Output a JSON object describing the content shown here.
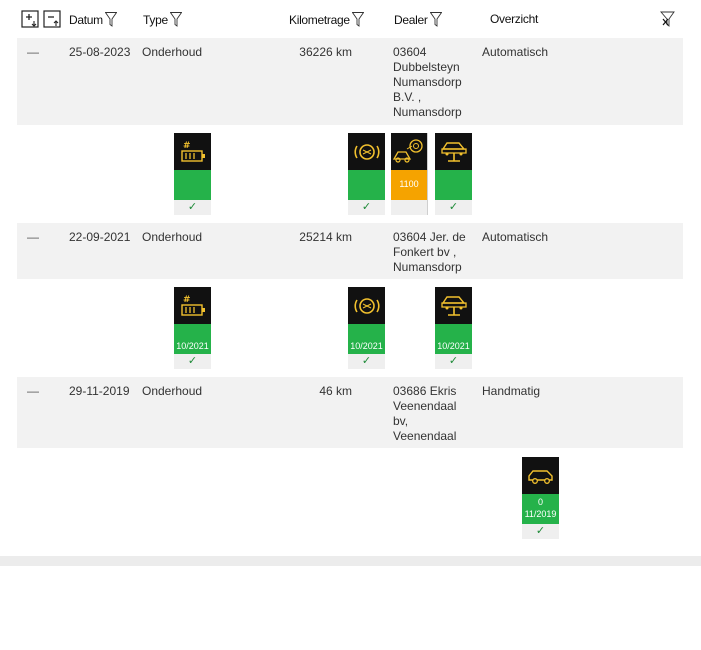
{
  "header": {
    "datum": "Datum",
    "type": "Type",
    "kilometrage": "Kilometrage",
    "dealer": "Dealer",
    "overzicht": "Overzicht"
  },
  "records": [
    {
      "dash": "—",
      "date": "25-08-2023",
      "type": "Onderhoud",
      "km": "36226 km",
      "dealer": [
        "03604",
        "Dubbelsteyn",
        "Numansdorp",
        "B.V. ,",
        "Numansdorp"
      ],
      "overzicht": "Automatisch"
    },
    {
      "dash": "—",
      "date": "22-09-2021",
      "type": "Onderhoud",
      "km": "25214 km",
      "dealer": [
        "03604 Jer. de",
        "Fonkert bv ,",
        "Numansdorp"
      ],
      "overzicht": "Automatisch"
    },
    {
      "dash": "—",
      "date": "29-11-2019",
      "type": "Onderhoud",
      "km": "46 km",
      "dealer": [
        "03686 Ekris",
        "Veenendaal",
        "bv,",
        "Veenendaal"
      ],
      "overzicht": "Handmatig"
    }
  ],
  "tiles": {
    "r1": {
      "oil": "",
      "brake_value": "1100",
      "check": "✓"
    },
    "r2": {
      "battery_date": "10/2021",
      "brake_date": "10/2021",
      "lift_date": "10/2021",
      "check": "✓"
    },
    "r3": {
      "car_value": "0",
      "car_date": "11/2019",
      "check": "✓"
    }
  },
  "colors": {
    "status_green": "#25b24a",
    "status_orange": "#f5a300",
    "icon_yellow": "#f2c12e",
    "row_bg": "#f2f2f2"
  },
  "icons": [
    "expand-all-icon",
    "collapse-all-icon",
    "filter-icon",
    "clear-filter-icon",
    "battery-service-icon",
    "brake-warning-icon",
    "brake-pad-service-icon",
    "vehicle-lift-icon",
    "vehicle-check-icon"
  ]
}
